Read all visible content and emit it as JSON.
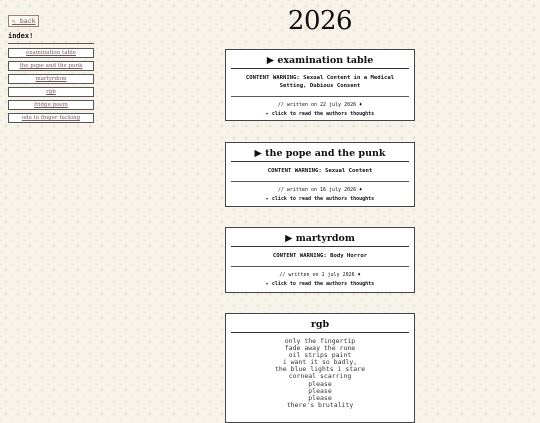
{
  "back_label": "⇖ back",
  "index_title": "index!",
  "nav": [
    "examination table",
    "the pope and the punk",
    "martyrdom",
    "rgb",
    "fridge poem",
    "ode to finger fucking"
  ],
  "site_title": "2026",
  "cards": [
    {
      "title": "▶ examination table",
      "warning": "CONTENT WARNING: Sexual Content in a Medical Setting, Dubious Consent",
      "written": "// written on 22 july 2026 ♦",
      "thoughts": "▸ click to read the authors thoughts"
    },
    {
      "title": "▶ the pope and the punk",
      "warning": "CONTENT WARNING: Sexual Content",
      "written": "// written on 16 july 2026 ♦",
      "thoughts": "▸ click to read the authors thoughts"
    },
    {
      "title": "▶ martyrdom",
      "warning": "CONTENT WARNING: Body Horror",
      "written": "// written on 1 july 2026 ♦",
      "thoughts": "▸ click to read the authors thoughts"
    }
  ],
  "poem_card": {
    "title": "rgb",
    "lines": [
      "only the fingertip",
      "fade away the rune",
      "oil strips paint",
      "i want it so badly,",
      "the blue lights i stare",
      "corneal scarring",
      "please",
      "please",
      "please",
      "there's brutality"
    ]
  }
}
